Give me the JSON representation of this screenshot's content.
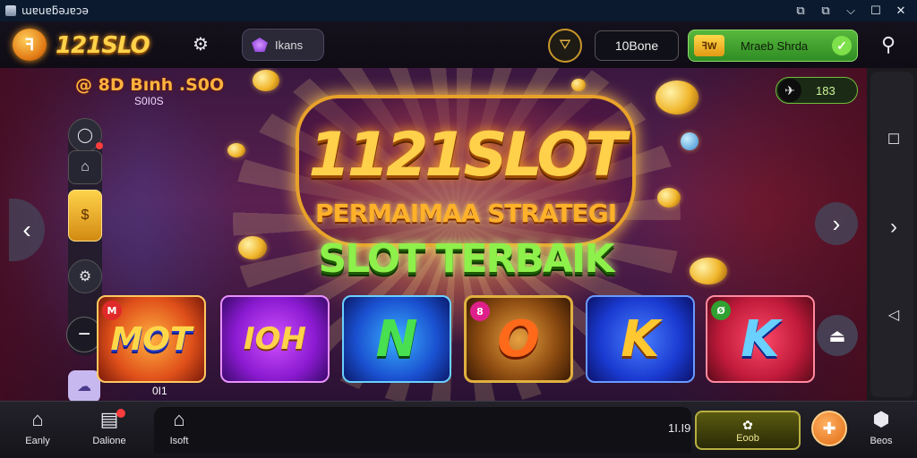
{
  "window": {
    "title": "ɯɐuɐƃǝɹɐɔǝ",
    "controls": [
      "⧉",
      "⧉",
      "⌵",
      "☐",
      "✕"
    ]
  },
  "header": {
    "logo_badge": "ꟻ",
    "logo_text": "121SLO",
    "gear_icon": "⚙",
    "pill_label": "Ikans",
    "basket_icon": "⛛",
    "balance": "10Bone",
    "deposit_tag": "ꟻW",
    "deposit_label": "Mraeb Shrda",
    "deposit_check": "✓",
    "search_icon": "⚲"
  },
  "promo": {
    "line1": "@ 8D Bınh .S0O",
    "line2": "S0I0S"
  },
  "mini_chip": {
    "icon": "✈",
    "value": "183"
  },
  "banner": {
    "title": "1121SLOT",
    "subtitle": "PERMAIMAA STRATEGI",
    "tagline": "SLOT TERBAIK"
  },
  "left_controls": {
    "avatar_icon": "◯",
    "bag_icon": "⌂",
    "gold_icon": "$",
    "gear_icon": "⚙",
    "minus_icon": "−",
    "ghost_icon": "☁",
    "ghost_label": "0I1"
  },
  "navigation": {
    "prev": "‹",
    "next": "›",
    "upload": "⏏"
  },
  "tiles": [
    {
      "label": "MOT",
      "badge": "M",
      "badge_color": "#e02a2a"
    },
    {
      "label": "IOH",
      "badge": "",
      "badge_color": ""
    },
    {
      "label": "N",
      "badge": "",
      "badge_color": ""
    },
    {
      "label": "O",
      "badge": "8",
      "badge_color": "#e0208a"
    },
    {
      "label": "K",
      "badge": "",
      "badge_color": ""
    },
    {
      "label": "K",
      "badge": "Ø",
      "badge_color": "#30a030"
    }
  ],
  "right_sidebar": {
    "square_icon": "☐",
    "chevron_icon": "›",
    "back_icon": "◁"
  },
  "bottom_nav": {
    "items": [
      {
        "icon": "⌂",
        "label": "Eanly"
      },
      {
        "icon": "▤",
        "label": "Dalione"
      },
      {
        "icon": "⌂",
        "label": "Isoft"
      }
    ],
    "value": "1I.I9",
    "claim_icon": "✿",
    "claim_label": "Eoob",
    "fab_icon": "✚",
    "last_icon": "⬢",
    "last_label": "Beos"
  },
  "colors": {
    "accent_gold": "#ffd04a",
    "accent_green": "#8ef04a",
    "deposit_green": "#58b73c",
    "background": "#0d0a1a"
  }
}
